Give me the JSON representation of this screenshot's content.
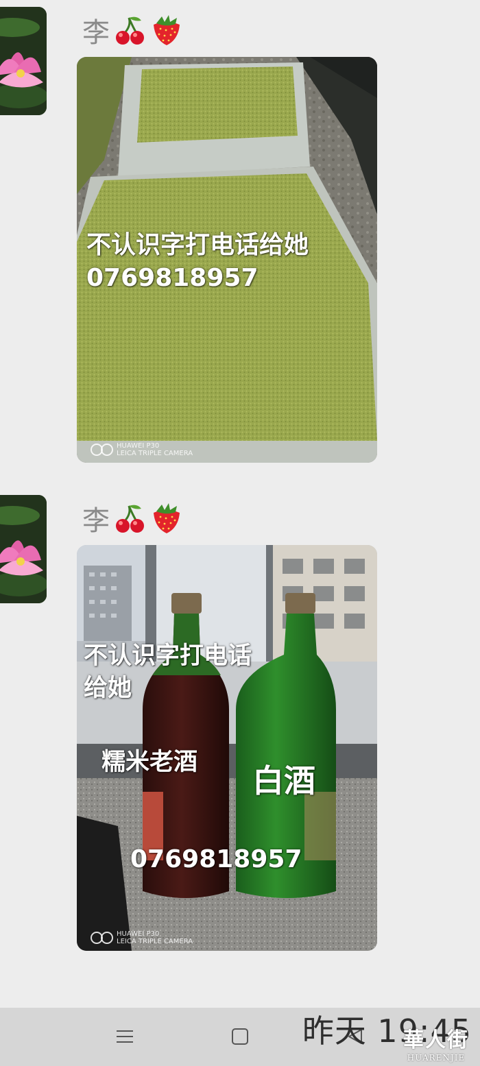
{
  "messages": [
    {
      "sender": "李",
      "sender_emojis": [
        "cherry-icon",
        "strawberry-icon"
      ],
      "overlay_lines": [
        "不认识字打电话给她",
        "0769818957"
      ],
      "watermark": [
        "HUAWEI P30",
        "LEICA TRIPLE CAMERA"
      ]
    },
    {
      "sender": "李",
      "sender_emojis": [
        "cherry-icon",
        "strawberry-icon"
      ],
      "overlay_lines": [
        "不认识字打电话",
        "给她"
      ],
      "label_left": "糯米老酒",
      "label_right": "白酒",
      "phone": "0769818957",
      "watermark": [
        "HUAWEI P30",
        "LEICA TRIPLE CAMERA"
      ]
    }
  ],
  "timestamp": "昨天 19:45",
  "nav": {
    "icons": [
      "menu-icon",
      "home-icon",
      "back-icon"
    ]
  },
  "logo": {
    "cn": "華人街",
    "en": "HUARENJIE"
  }
}
